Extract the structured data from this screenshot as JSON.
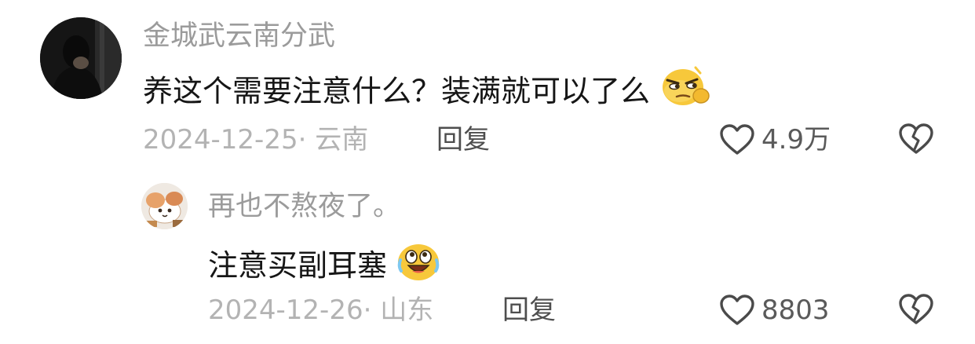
{
  "comments": [
    {
      "username": "金城武云南分武",
      "text": "养这个需要注意什么？装满就可以了么",
      "emoji": "thinking-side-eye-emoji",
      "date": "2024-12-25",
      "location": "云南",
      "reply_label": "回复",
      "likes": "4.9万",
      "avatar": "dark-hooded-figure-avatar"
    },
    {
      "username": "再也不熬夜了。",
      "text": "注意买副耳塞",
      "emoji": "crying-laughing-emoji",
      "date": "2024-12-26",
      "location": "山东",
      "reply_label": "回复",
      "likes": "8803",
      "avatar": "cartoon-cat-avatar"
    }
  ],
  "colors": {
    "username": "#9b9b9b",
    "text": "#161616",
    "meta": "#b3b3b3",
    "icon": "#4a4a4a",
    "emoji_yellow": "#f7c83b"
  },
  "icons": {
    "like": "heart-outline-icon",
    "dislike": "broken-heart-icon"
  }
}
